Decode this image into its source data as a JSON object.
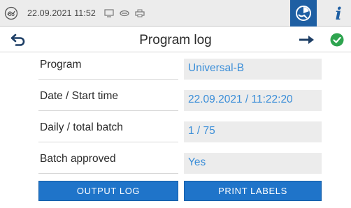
{
  "status": {
    "datetime": "22.09.2021 11:52",
    "icons": [
      "device-logo-icon",
      "monitor-icon",
      "link-icon",
      "printer-icon",
      "connection-icon",
      "info-icon"
    ],
    "info_label": "i",
    "accent": "#1e5fa3"
  },
  "titlebar": {
    "title": "Program log",
    "back_icon": "back-arrow-icon",
    "next_icon": "right-arrow-icon",
    "status_icon": "check-circle-icon",
    "status_color": "#2ea44f"
  },
  "rows": [
    {
      "label": "Program",
      "value": "Universal-B"
    },
    {
      "label": "Date / Start time",
      "value": "22.09.2021 / 11:22:20"
    },
    {
      "label": "Daily / total batch",
      "value": "1 / 75"
    },
    {
      "label": "Batch approved",
      "value": "Yes"
    }
  ],
  "buttons": {
    "output_log": "OUTPUT LOG",
    "print_labels": "PRINT LABELS"
  },
  "colors": {
    "button": "#1f74c9",
    "value_text": "#3b8ed8",
    "value_bg": "#ececec"
  }
}
